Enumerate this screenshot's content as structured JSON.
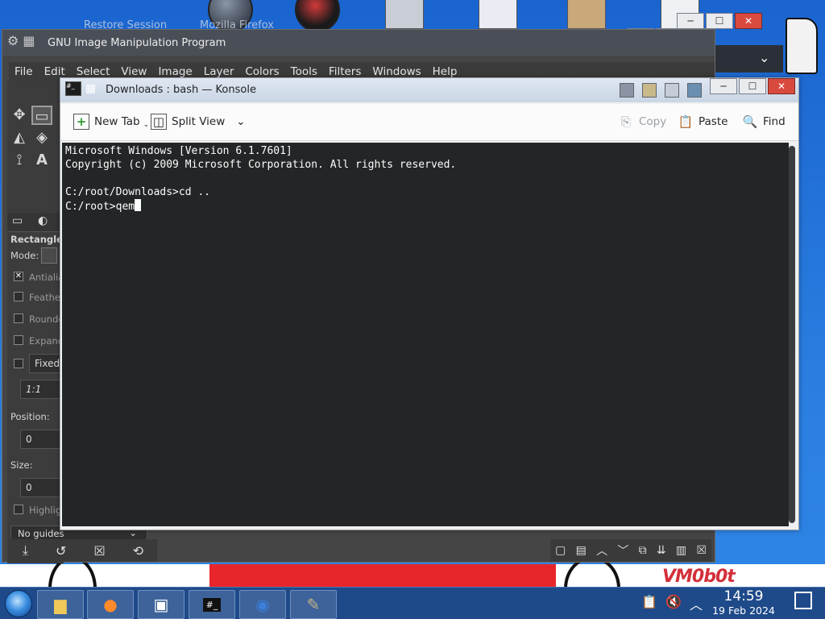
{
  "background": {
    "session_title": "Restore Session",
    "firefox_title": "Mozilla Firefox",
    "watermark": "VM0b0t"
  },
  "gimp": {
    "title": "GNU Image Manipulation Program",
    "menu": [
      "File",
      "Edit",
      "Select",
      "View",
      "Image",
      "Layer",
      "Colors",
      "Tools",
      "Filters",
      "Windows",
      "Help"
    ],
    "tool_options": {
      "title": "Rectangle S",
      "mode_label": "Mode:",
      "antialias": "Antialia",
      "feather": "Feather",
      "rounded": "Rounde",
      "expand": "Expand",
      "fixed": "Fixed",
      "ratio": "1:1",
      "position_label": "Position:",
      "position_value": "0",
      "size_label": "Size:",
      "size_value": "0",
      "highlight": "Highlig",
      "guides": "No guides"
    }
  },
  "konsole": {
    "title": "Downloads : bash — Konsole",
    "toolbar": {
      "new_tab": "New Tab",
      "split_view": "Split View",
      "copy": "Copy",
      "paste": "Paste",
      "find": "Find"
    },
    "terminal_lines": [
      "Microsoft Windows [Version 6.1.7601]",
      "Copyright (c) 2009 Microsoft Corporation. All rights reserved.",
      "",
      "C:/root/Downloads>cd ..",
      "C:/root>qem"
    ]
  },
  "taskbar": {
    "time": "14:59",
    "date": "19 Feb 2024"
  },
  "colors": {
    "terminal_bg": "#232627",
    "terminal_fg": "#fcfcfc",
    "gimp_bg": "#454545",
    "taskbar_bg": "#1e4a8a",
    "desktop_bg": "#1f6fd6"
  }
}
